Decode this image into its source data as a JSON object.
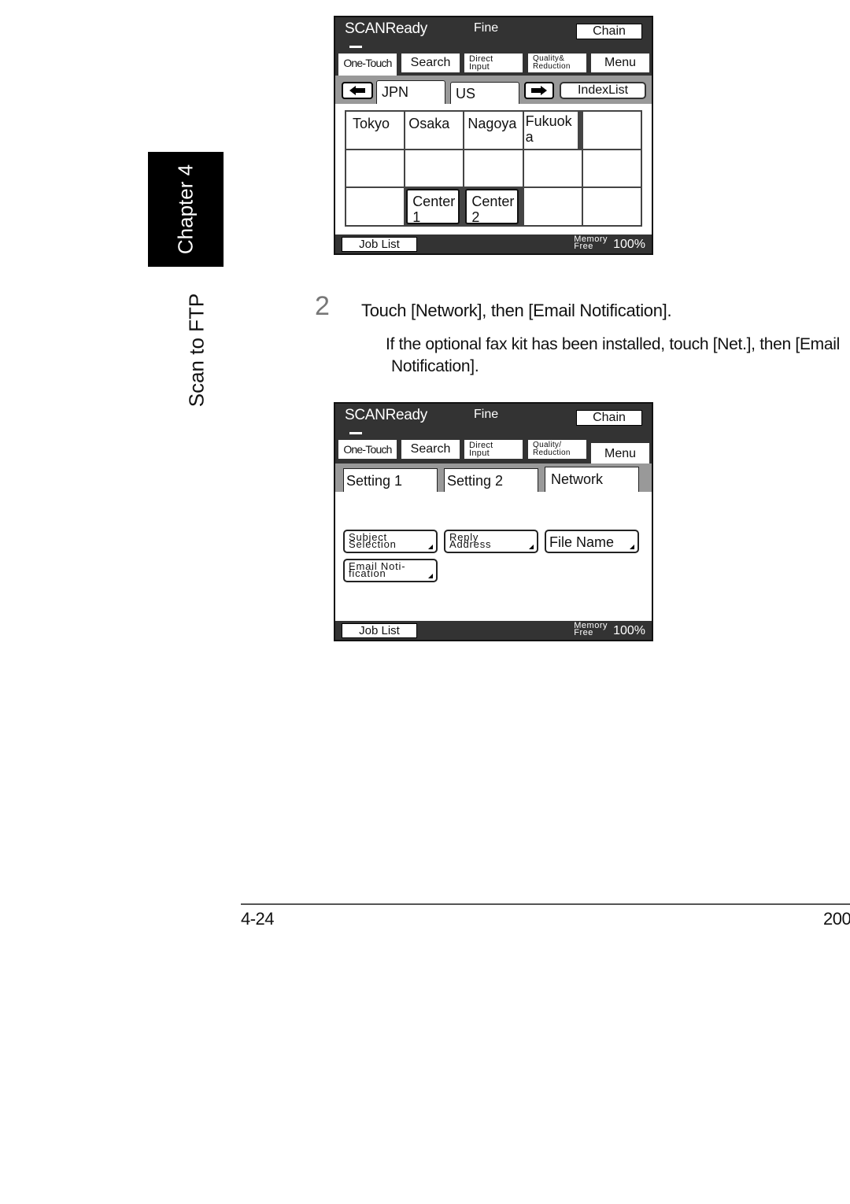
{
  "sidebar": {
    "chapter": "Chapter 4",
    "section": "Scan to FTP"
  },
  "screen1": {
    "status": {
      "mode": "SCANReady",
      "quality": "Fine",
      "chain": "Chain"
    },
    "mode_tabs": [
      {
        "label": "One-Touch",
        "active": true
      },
      {
        "label": "Search"
      },
      {
        "label_line1": "Direct",
        "label_line2": "Input"
      },
      {
        "label_line1": "Quality&",
        "label_line2": "Reduction"
      },
      {
        "label": "Menu"
      }
    ],
    "nav": {
      "prev_icon": "arrow-left-icon",
      "next_icon": "arrow-right-icon",
      "index_list": "IndexList"
    },
    "dest_tabs": [
      {
        "label": "JPN",
        "active": true
      },
      {
        "label": "US"
      }
    ],
    "grid": [
      [
        "Tokyo",
        "Osaka",
        "Nagoya",
        "Fukuoka",
        ""
      ],
      [
        "",
        "",
        "",
        "",
        ""
      ],
      [
        "",
        "Center 1",
        "Center 2",
        "",
        ""
      ]
    ],
    "bottom": {
      "job_list": "Job List",
      "memory_line1": "Memory",
      "memory_line2": "Free",
      "memory_pct": "100%"
    }
  },
  "step": {
    "number": "2",
    "instruction": "Touch [Network], then [Email Notification].",
    "note_line1": "If the optional fax kit has been installed, touch [Net.], then [Email",
    "note_line2": "Notification]."
  },
  "screen2": {
    "status": {
      "mode": "SCANReady",
      "quality": "Fine",
      "chain": "Chain"
    },
    "mode_tabs": [
      {
        "label": "One-Touch"
      },
      {
        "label": "Search"
      },
      {
        "label_line1": "Direct",
        "label_line2": "Input"
      },
      {
        "label_line1": "Quality/",
        "label_line2": "Reduction"
      },
      {
        "label": "Menu",
        "active": true
      }
    ],
    "setting_tabs": [
      {
        "label": "Setting 1"
      },
      {
        "label": "Setting 2"
      },
      {
        "label": "Network",
        "active": true
      }
    ],
    "functions": [
      {
        "line1": "Subject",
        "line2": "Selection"
      },
      {
        "line1": "Reply",
        "line2": "Address"
      },
      {
        "label": "File Name"
      },
      {
        "line1": "Email Noti-",
        "line2": "fication"
      }
    ],
    "bottom": {
      "job_list": "Job List",
      "memory_line1": "Memory",
      "memory_line2": "Free",
      "memory_pct": "100%"
    }
  },
  "footer": {
    "page_number": "4-24",
    "right_text": "200"
  }
}
